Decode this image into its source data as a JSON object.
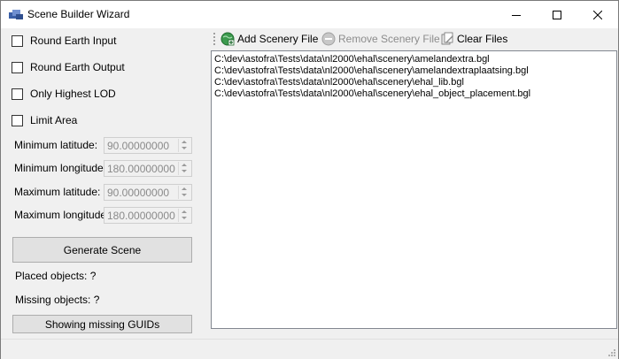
{
  "window": {
    "title": "Scene Builder Wizard",
    "controls": {
      "minimize": "minimize-icon",
      "maximize": "maximize-icon",
      "close": "close-icon"
    }
  },
  "options": {
    "round_earth_input": {
      "label": "Round Earth Input",
      "checked": false
    },
    "round_earth_output": {
      "label": "Round Earth Output",
      "checked": false
    },
    "only_highest_lod": {
      "label": "Only Highest LOD",
      "checked": false
    },
    "limit_area": {
      "label": "Limit Area",
      "checked": false
    }
  },
  "area": {
    "min_lat": {
      "label": "Minimum latitude:",
      "value": "90.00000000"
    },
    "min_lon": {
      "label": "Minimum longitude:",
      "value": "180.00000000"
    },
    "max_lat": {
      "label": "Maximum latitude:",
      "value": "90.00000000"
    },
    "max_lon": {
      "label": "Maximum longitude:",
      "value": "180.00000000"
    }
  },
  "actions": {
    "generate": "Generate Scene",
    "placed_objects": "Placed objects: ?",
    "missing_objects": "Missing objects: ?",
    "show_missing": "Showing missing GUIDs"
  },
  "toolbar": {
    "add": "Add Scenery File",
    "remove": "Remove Scenery File",
    "clear": "Clear Files"
  },
  "files": [
    "C:\\dev\\astofra\\Tests\\data\\nl2000\\ehal\\scenery\\amelandextra.bgl",
    "C:\\dev\\astofra\\Tests\\data\\nl2000\\ehal\\scenery\\amelandextraplaatsing.bgl",
    "C:\\dev\\astofra\\Tests\\data\\nl2000\\ehal\\scenery\\ehal_lib.bgl",
    "C:\\dev\\astofra\\Tests\\data\\nl2000\\ehal\\scenery\\ehal_object_placement.bgl"
  ]
}
